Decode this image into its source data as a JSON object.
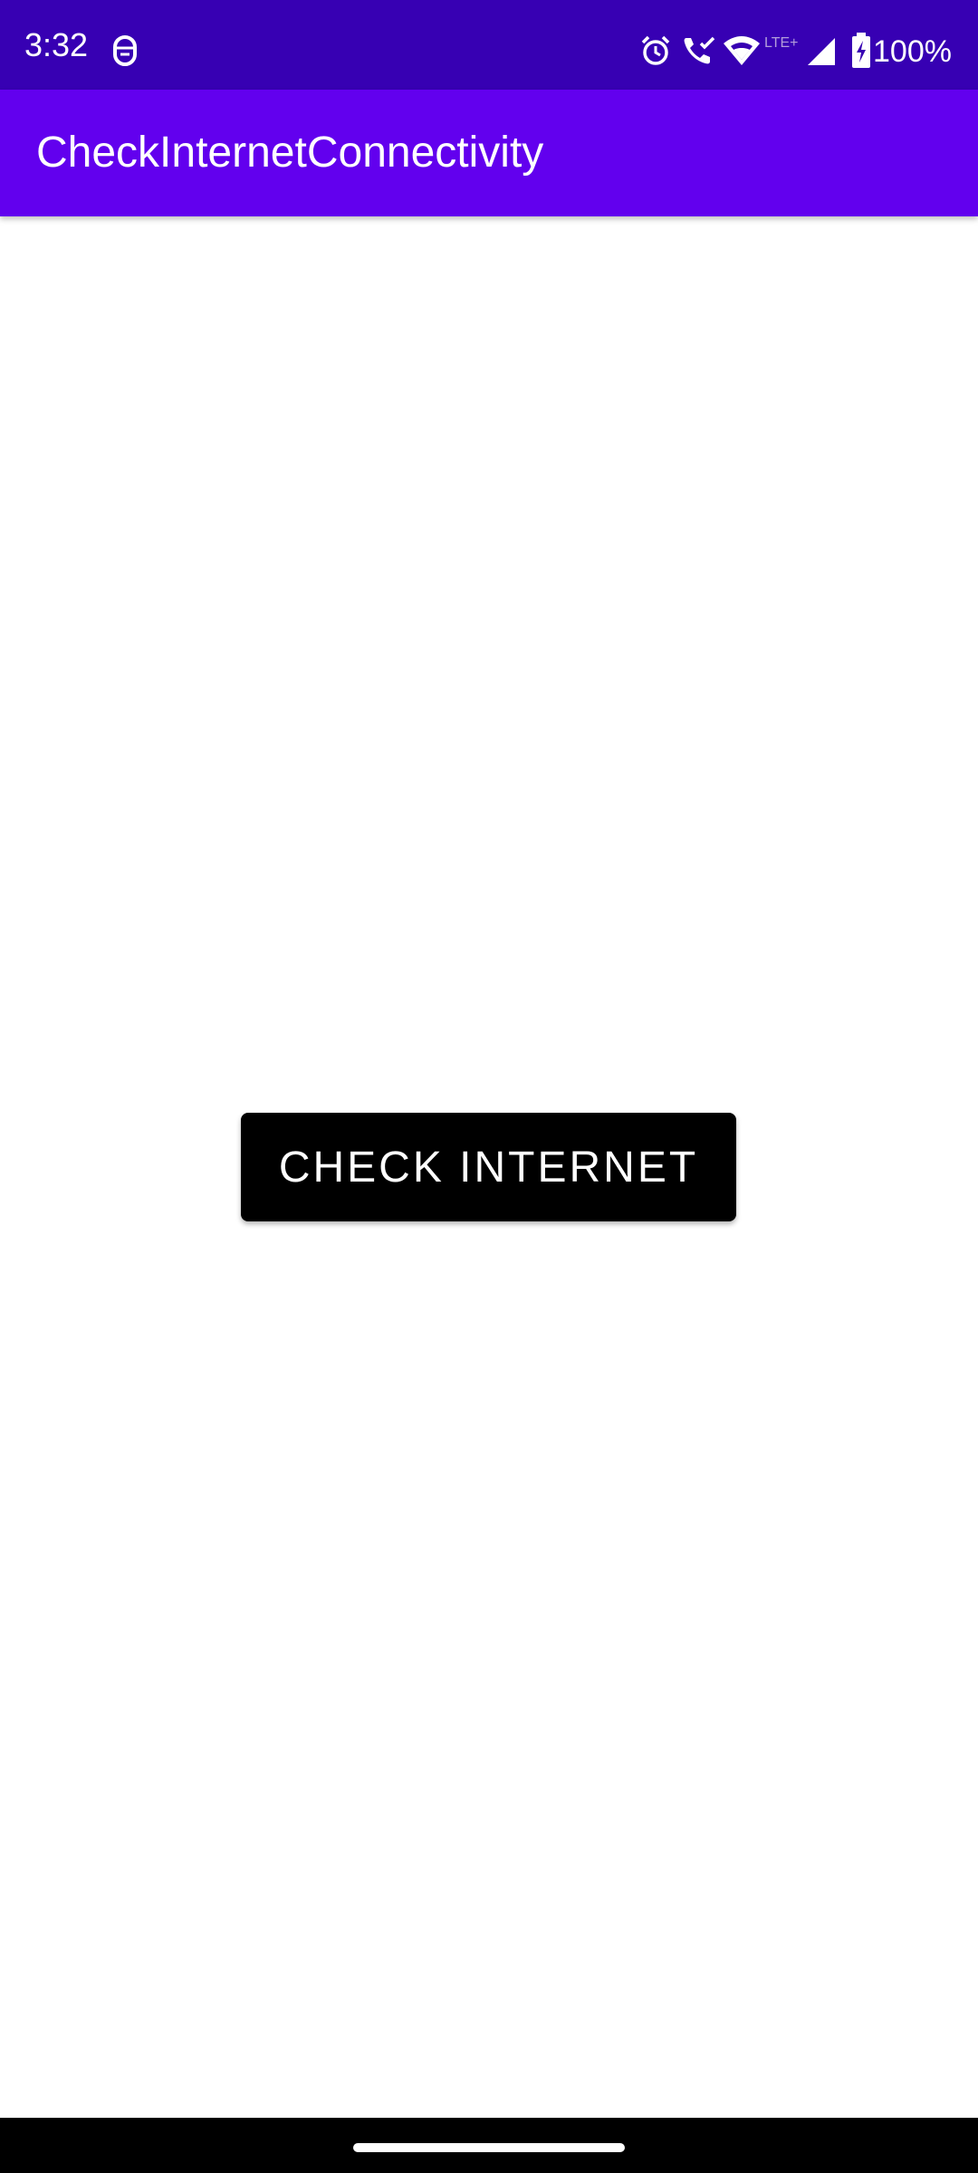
{
  "status_bar": {
    "time": "3:32",
    "network_type": "LTE+",
    "battery": "100%",
    "background_color": "#3700b3",
    "icons": [
      "notification-icon",
      "alarm-icon",
      "wifi-calling-icon",
      "wifi-icon",
      "signal-icon",
      "battery-charging-icon"
    ]
  },
  "app_bar": {
    "title": "CheckInternetConnectivity",
    "background_color": "#6200ee"
  },
  "main": {
    "button_label": "CHECK INTERNET",
    "button_color": "#000000"
  },
  "nav_bar": {
    "background_color": "#000000"
  }
}
